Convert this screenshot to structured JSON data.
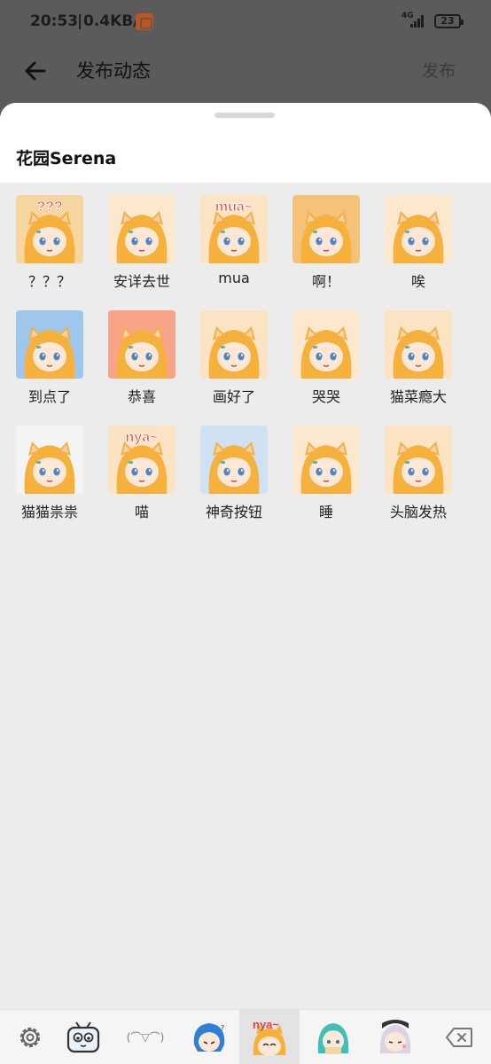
{
  "status_bar": {
    "time": "20:53",
    "separator": "|",
    "speed": "0.4KB/s",
    "network": "4G",
    "battery": "23"
  },
  "app_bar": {
    "title": "发布动态",
    "publish": "发布"
  },
  "sheet": {
    "title": "花园Serena",
    "stickers": [
      {
        "label": "？？？",
        "overlay": "???",
        "icon": "confused-girl-sticker",
        "bg": "#f6d6a0"
      },
      {
        "label": "安详去世",
        "overlay": "",
        "icon": "ghost-girl-sticker",
        "bg": "#fbe8cf"
      },
      {
        "label": "mua",
        "overlay": "mua~",
        "icon": "kiss-girl-sticker",
        "bg": "#fbe3c3"
      },
      {
        "label": "啊！",
        "overlay": "",
        "icon": "shouting-girl-sticker",
        "bg": "#f5c27a"
      },
      {
        "label": "唉",
        "overlay": "",
        "icon": "sigh-girl-sticker",
        "bg": "#fbe8cf"
      },
      {
        "label": "到点了",
        "overlay": "",
        "icon": "clock-girl-sticker",
        "bg": "#9fc7ee"
      },
      {
        "label": "恭喜",
        "overlay": "",
        "icon": "party-popper-girl-sticker",
        "bg": "#f7a488"
      },
      {
        "label": "画好了",
        "overlay": "",
        "icon": "drawing-girl-sticker",
        "bg": "#fbe3c3"
      },
      {
        "label": "哭哭",
        "overlay": "",
        "icon": "crying-girl-sticker",
        "bg": "#fbe8cf"
      },
      {
        "label": "猫菜瘾大",
        "overlay": "",
        "icon": "gamer-girl-sticker",
        "bg": "#fbe3c3"
      },
      {
        "label": "猫猫祟祟",
        "overlay": "",
        "icon": "peeking-girl-sticker",
        "bg": "#f4f4f4"
      },
      {
        "label": "喵",
        "overlay": "nya~",
        "icon": "meow-girl-sticker",
        "bg": "#fbe3c3"
      },
      {
        "label": "神奇按钮",
        "overlay": "",
        "icon": "button-girl-sticker",
        "bg": "#cfe1f3"
      },
      {
        "label": "睡",
        "overlay": "",
        "icon": "sleeping-girl-sticker",
        "bg": "#fbe8cf"
      },
      {
        "label": "头脑发热",
        "overlay": "",
        "icon": "overheated-girl-sticker",
        "bg": "#fbe3c3"
      }
    ]
  },
  "toolbar": {
    "kaomoji": "(⌒▽⌒)",
    "items": [
      "settings-icon",
      "tv-mascot-emoji-tab",
      "kaomoji-tab",
      "blue-hair-sticker-tab",
      "serena-sticker-tab",
      "teal-hair-sticker-tab",
      "silver-hair-sticker-tab",
      "backspace-icon"
    ],
    "colors": {
      "accent_red": "#e8413e",
      "hair": "#f5b13c",
      "skin": "#fde8d8"
    }
  }
}
